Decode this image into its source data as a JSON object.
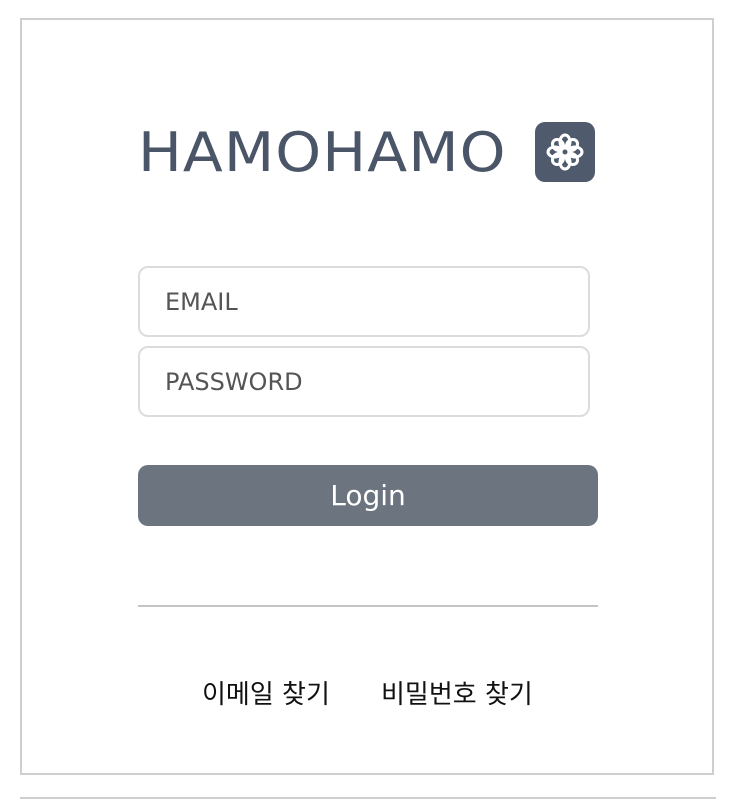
{
  "brand": {
    "name": "HAMOHAMO",
    "logo_icon": "flower-icon",
    "text_color": "#4a5568",
    "badge_color": "#4f5b6d"
  },
  "form": {
    "email_placeholder": "EMAIL",
    "password_placeholder": "PASSWORD",
    "login_label": "Login",
    "button_color": "#6c747f"
  },
  "links": {
    "find_email": "이메일 찾기",
    "find_password": "비밀번호 찾기"
  }
}
